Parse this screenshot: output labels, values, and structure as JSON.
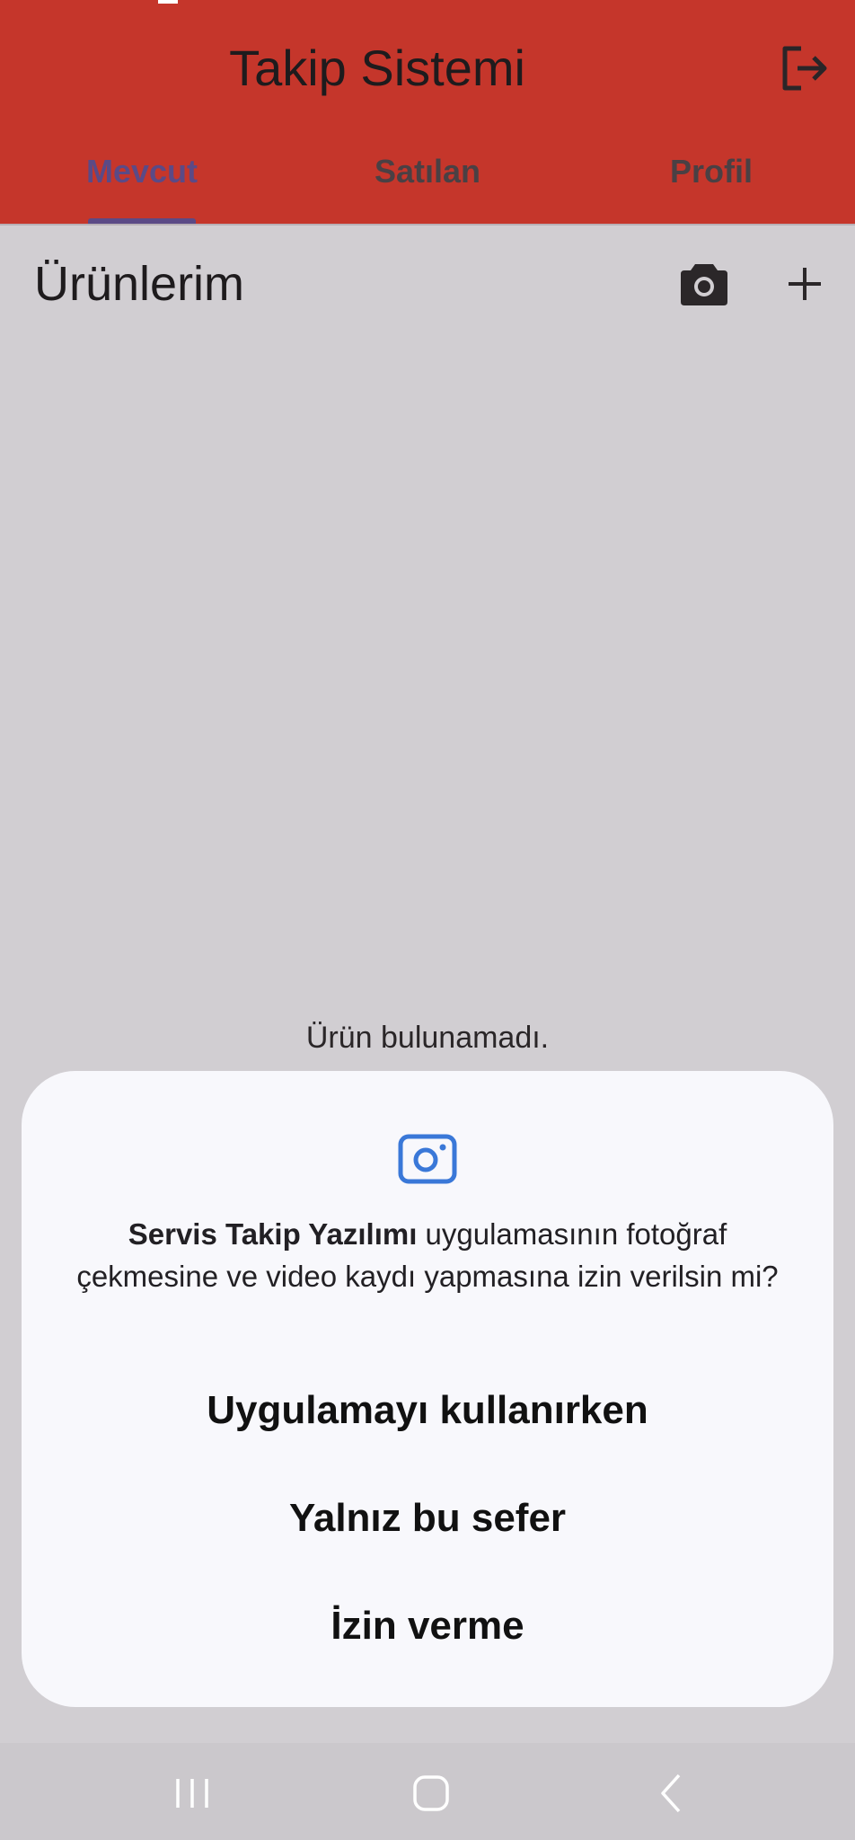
{
  "app": {
    "title": "Takip Sistemi"
  },
  "tabs": [
    {
      "label": "Mevcut",
      "active": true
    },
    {
      "label": "Satılan",
      "active": false
    },
    {
      "label": "Profil",
      "active": false
    }
  ],
  "section": {
    "title": "Ürünlerim"
  },
  "empty_state": {
    "text": "Ürün bulunamadı."
  },
  "dialog": {
    "app_name": "Servis Takip Yazılımı",
    "message": " uygulamasının fotoğraf çekmesine ve video kaydı yapmasına izin verilsin mi?",
    "options": [
      "Uygulamayı kullanırken",
      "Yalnız bu sefer",
      "İzin verme"
    ]
  },
  "icons": {
    "logout": "logout-icon",
    "camera": "camera-icon",
    "add": "plus-icon",
    "dialog": "camera-permission-icon",
    "nav_recents": "recents-icon",
    "nav_home": "home-icon",
    "nav_back": "back-icon"
  },
  "colors": {
    "appbar": "#c5362b",
    "active_tab": "#5b4a86",
    "background": "#d1ced2",
    "dialog_bg": "#f8f8fc",
    "dialog_icon": "#3a78d8"
  }
}
